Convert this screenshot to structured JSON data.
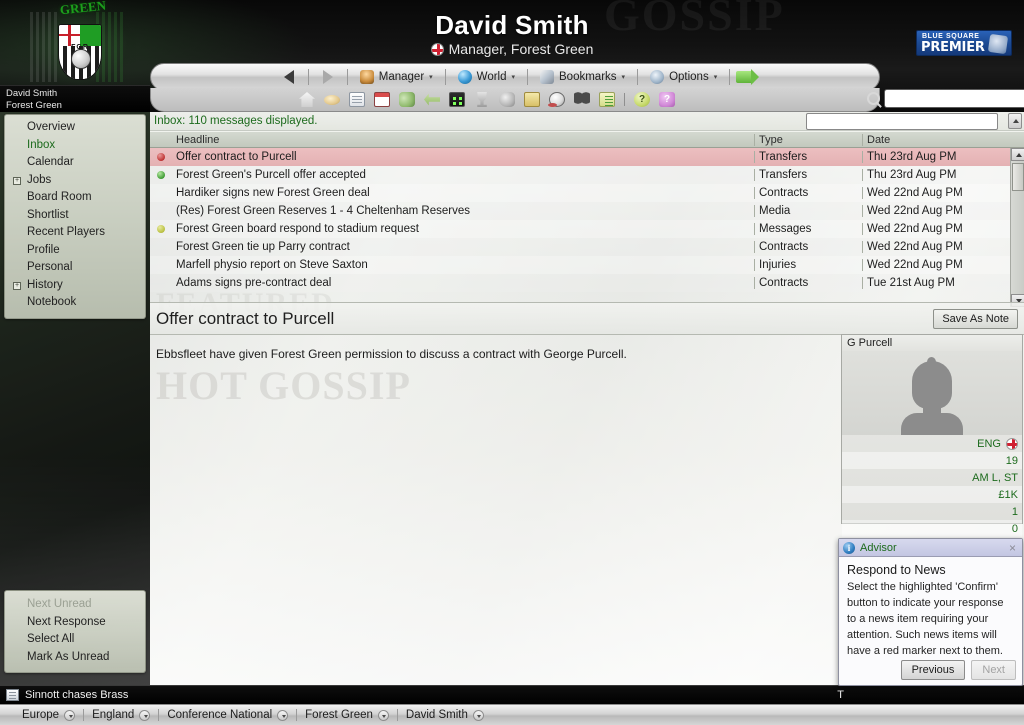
{
  "banner": {
    "title": "David Smith",
    "subtitle": "Manager, Forest Green",
    "crest_text": "GREEN",
    "crest_initials": "FGR",
    "league_logo_line1": "BLUE SQUARE",
    "league_logo_line2": "PREMIER",
    "ghost_text": "GOSSIP"
  },
  "manager_tag": {
    "name": "David Smith",
    "club": "Forest Green"
  },
  "nav": {
    "back_label": "Back",
    "forward_label": "Forward",
    "items": [
      {
        "label": "Manager",
        "icon": "manager-icon"
      },
      {
        "label": "World",
        "icon": "globe-icon"
      },
      {
        "label": "Bookmarks",
        "icon": "book-icon"
      },
      {
        "label": "Options",
        "icon": "options-icon"
      }
    ],
    "go_label": "Go"
  },
  "toolbar_icons": [
    "home-icon",
    "ball-oval-icon",
    "fixtures-list-icon",
    "calendar-icon",
    "squad-people-icon",
    "transfers-arrow-icon",
    "scoreboard-icon",
    "trophy-icon",
    "whistle-icon",
    "clipboard-icon",
    "football-icon",
    "binoculars-icon",
    "news-list-icon",
    "help-icon",
    "tips-icon"
  ],
  "search": {
    "value": "",
    "placeholder": ""
  },
  "sidebar": {
    "items": [
      {
        "label": "Overview",
        "expandable": false,
        "selected": false,
        "disabled": false
      },
      {
        "label": "Inbox",
        "expandable": false,
        "selected": true,
        "disabled": false
      },
      {
        "label": "Calendar",
        "expandable": false,
        "selected": false,
        "disabled": false
      },
      {
        "label": "Jobs",
        "expandable": true,
        "selected": false,
        "disabled": false
      },
      {
        "label": "Board Room",
        "expandable": false,
        "selected": false,
        "disabled": false
      },
      {
        "label": "Shortlist",
        "expandable": false,
        "selected": false,
        "disabled": false
      },
      {
        "label": "Recent Players",
        "expandable": false,
        "selected": false,
        "disabled": false
      },
      {
        "label": "Profile",
        "expandable": false,
        "selected": false,
        "disabled": false
      },
      {
        "label": "Personal",
        "expandable": false,
        "selected": false,
        "disabled": false
      },
      {
        "label": "History",
        "expandable": true,
        "selected": false,
        "disabled": false
      },
      {
        "label": "Notebook",
        "expandable": false,
        "selected": false,
        "disabled": false
      }
    ],
    "actions": [
      {
        "label": "Next Unread",
        "disabled": true
      },
      {
        "label": "Next Response",
        "disabled": false
      },
      {
        "label": "Select All",
        "disabled": false
      },
      {
        "label": "Mark As Unread",
        "disabled": false
      }
    ]
  },
  "inbox": {
    "status": "Inbox: 110 messages displayed.",
    "filter_value": "",
    "columns": [
      "Headline",
      "Type",
      "Date"
    ],
    "messages": [
      {
        "marker": "red",
        "headline": "Offer contract to Purcell",
        "type": "Transfers",
        "date": "Thu 23rd Aug PM",
        "selected": true
      },
      {
        "marker": "green",
        "headline": "Forest Green's Purcell offer accepted",
        "type": "Transfers",
        "date": "Thu 23rd Aug PM",
        "selected": false
      },
      {
        "marker": "none",
        "headline": "Hardiker signs new Forest Green deal",
        "type": "Contracts",
        "date": "Wed 22nd Aug PM",
        "selected": false
      },
      {
        "marker": "none",
        "headline": "(Res) Forest Green Reserves 1 - 4 Cheltenham Reserves",
        "type": "Media",
        "date": "Wed 22nd Aug PM",
        "selected": false
      },
      {
        "marker": "yellow",
        "headline": "Forest Green board respond to stadium request",
        "type": "Messages",
        "date": "Wed 22nd Aug PM",
        "selected": false
      },
      {
        "marker": "none",
        "headline": "Forest Green tie up Parry contract",
        "type": "Contracts",
        "date": "Wed 22nd Aug PM",
        "selected": false
      },
      {
        "marker": "none",
        "headline": "Marfell physio report on Steve Saxton",
        "type": "Injuries",
        "date": "Wed 22nd Aug PM",
        "selected": false
      },
      {
        "marker": "none",
        "headline": "Adams signs pre-contract deal",
        "type": "Contracts",
        "date": "Tue 21st Aug PM",
        "selected": false
      }
    ]
  },
  "article": {
    "title": "Offer contract to Purcell",
    "save_button": "Save As Note",
    "body": "Ebbsfleet have given Forest Green permission to discuss a contract with George Purcell."
  },
  "player_card": {
    "name": "G Purcell",
    "attributes": [
      {
        "value": "ENG",
        "flag": true
      },
      {
        "value": "19",
        "flag": false
      },
      {
        "value": "AM L, ST",
        "flag": false
      },
      {
        "value": "£1K",
        "flag": false
      },
      {
        "value": "1",
        "flag": false
      },
      {
        "value": "0",
        "flag": false
      }
    ]
  },
  "advisor": {
    "window_title": "Advisor",
    "heading": "Respond to News",
    "body": "Select the highlighted 'Confirm' button to indicate your response to a news item requiring your attention. Such news items will have a red marker next to them.",
    "previous_label": "Previous",
    "next_label": "Next",
    "close_label": "×"
  },
  "continue": {
    "label": "Continue"
  },
  "ticker": {
    "text": "Sinnott chases Brass",
    "right_text": "T"
  },
  "breadcrumb": [
    {
      "label": "Europe"
    },
    {
      "label": "England"
    },
    {
      "label": "Conference National"
    },
    {
      "label": "Forest Green"
    },
    {
      "label": "David Smith"
    }
  ],
  "colors": {
    "accent_green": "#1d6b1d",
    "selected_row": "#e4b1b3",
    "league_blue": "#1c4a93"
  }
}
